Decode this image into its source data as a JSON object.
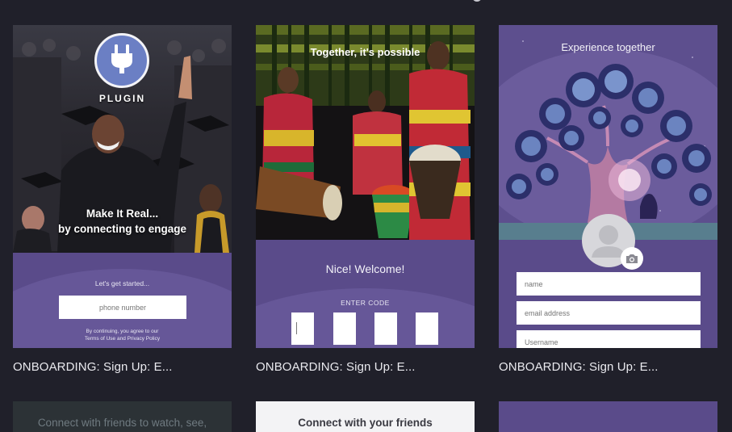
{
  "cards": [
    {
      "caption": "ONBOARDING: Sign Up: E...",
      "logo_text": "PLUGIN",
      "headline_line1": "Make It Real...",
      "headline_line2": "by connecting to engage",
      "prompt": "Let's get started...",
      "phone_placeholder": "phone number",
      "terms_line1": "By continuing, you agree to our",
      "terms_line2": "Terms of Use and Privacy Policy",
      "icon": "plug-icon"
    },
    {
      "caption": "ONBOARDING: Sign Up: E...",
      "title": "Together, it's possible",
      "welcome": "Nice! Welcome!",
      "enter_code_label": "ENTER CODE"
    },
    {
      "caption": "ONBOARDING: Sign Up: E...",
      "title": "Experience together",
      "name_placeholder": "name",
      "email_placeholder": "email address",
      "username_placeholder": "Username",
      "icons": [
        "avatar-placeholder-icon",
        "camera-icon"
      ]
    }
  ],
  "row2": [
    {
      "text": "Connect with friends to watch, see,"
    },
    {
      "text": "Connect with your friends"
    },
    {
      "text": ""
    }
  ],
  "colors": {
    "background": "#20202a",
    "card_purple": "#5a4b8a",
    "card_purple_light": "#665798",
    "plug_blue": "#6b7fc4"
  }
}
